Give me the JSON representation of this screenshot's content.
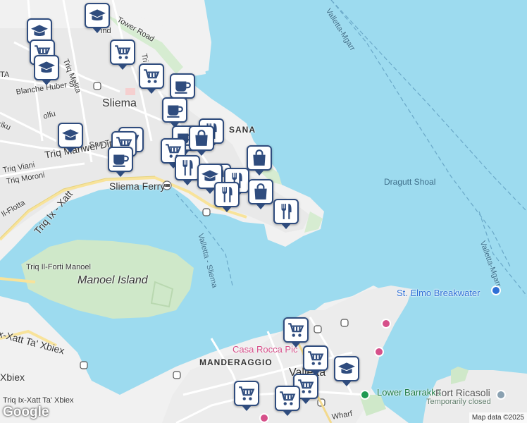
{
  "map": {
    "attribution": "Map data ©2025",
    "logo": "Google",
    "labels": {
      "tower_road": "Tower Road",
      "triq_melita": "Triq Melita",
      "blanche_huber": "Blanche Huber St",
      "sliema": "Sliema",
      "sana": "SANA",
      "triq_manwel": "Triq Manwel Dim",
      "triq_viani": "Triq Viani",
      "triq_moroni": "Triq Moroni",
      "sliema_ferry": "Sliema Ferry",
      "triq_ix_xatt": "Triq Ix - Xatt",
      "il_flotta": "Il-Flotta",
      "triq_forti_manoel": "Triq Il-Forti Manoel",
      "manoel_island": "Manoel Island",
      "xatt_ta_xbiex": "x-Xatt Ta' Xbiex",
      "xbiex": "Xbiex",
      "triq_ix_xatt_ta_xbiex": "Triq Ix-Xatt Ta' Xbiex",
      "valletta_sliema": "Valletta - Sliema",
      "valletta_mgarr_top": "Valletta-Mgarr",
      "valletta_mgarr_right": "Valletta-Mgarr",
      "dragutt_shoal": "Dragutt Shoal",
      "st_elmo": "St. Elmo Breakwater",
      "casa_rocca": "Casa Rocca Pic",
      "manderaggio": "MANDERAGGIO",
      "valletta": "Valletta",
      "lower_barrakka": "Lower Barrakka",
      "fort_ricasoli": "Fort Ricasoli",
      "temporarily_closed": "Temporarily closed",
      "wharf": "Wharf",
      "trik": "Triq",
      "tri_partial": "Tri",
      "triq_tal_partial": "Triq",
      "olfu": "olfu",
      "rikku": "riku",
      "ta_top": "TA",
      "ind": "ind",
      "san_trof": "San Trof"
    },
    "markers": [
      {
        "type": "school",
        "icon": "school-icon"
      },
      {
        "type": "school",
        "icon": "school-icon"
      },
      {
        "type": "shop",
        "icon": "shopping-cart-icon"
      },
      {
        "type": "shop",
        "icon": "shopping-cart-icon"
      },
      {
        "type": "school",
        "icon": "school-icon"
      },
      {
        "type": "shop",
        "icon": "shopping-cart-icon"
      },
      {
        "type": "cafe",
        "icon": "coffee-cup-icon"
      },
      {
        "type": "cafe",
        "icon": "coffee-cup-icon"
      },
      {
        "type": "school",
        "icon": "school-icon"
      },
      {
        "type": "restaurant",
        "icon": "fork-knife-icon"
      },
      {
        "type": "shop",
        "icon": "shopping-cart-icon"
      },
      {
        "type": "shop",
        "icon": "shopping-cart-icon"
      },
      {
        "type": "cafe",
        "icon": "coffee-cup-icon"
      },
      {
        "type": "bag",
        "icon": "shopping-bag-icon"
      },
      {
        "type": "shop",
        "icon": "shopping-cart-icon"
      },
      {
        "type": "cafe",
        "icon": "coffee-cup-icon"
      },
      {
        "type": "bag",
        "icon": "shopping-bag-icon"
      },
      {
        "type": "restaurant",
        "icon": "fork-knife-icon"
      },
      {
        "type": "restaurant",
        "icon": "fork-knife-icon"
      },
      {
        "type": "school",
        "icon": "school-icon"
      },
      {
        "type": "restaurant",
        "icon": "fork-knife-icon"
      },
      {
        "type": "bag",
        "icon": "shopping-bag-icon"
      },
      {
        "type": "restaurant",
        "icon": "fork-knife-icon"
      },
      {
        "type": "restaurant",
        "icon": "fork-knife-icon"
      },
      {
        "type": "shop",
        "icon": "shopping-cart-icon"
      },
      {
        "type": "shop",
        "icon": "shopping-cart-icon"
      },
      {
        "type": "shop",
        "icon": "shopping-cart-icon"
      },
      {
        "type": "school",
        "icon": "school-icon"
      },
      {
        "type": "shop",
        "icon": "shopping-cart-icon"
      },
      {
        "type": "shop",
        "icon": "shopping-cart-icon"
      }
    ]
  }
}
